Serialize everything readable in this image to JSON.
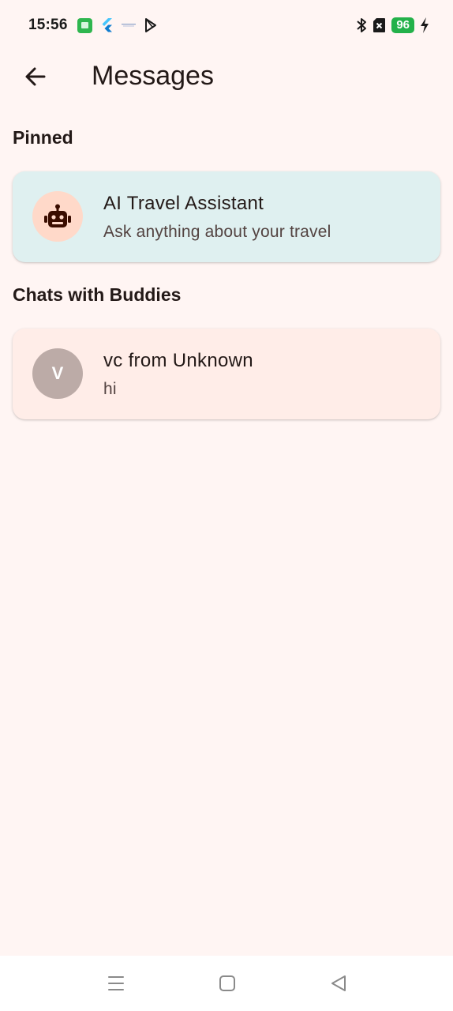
{
  "status_bar": {
    "time": "15:56",
    "battery": "96",
    "icons": [
      "green-app-icon",
      "flutter-icon",
      "notification-dots-icon",
      "play-store-icon",
      "bluetooth-icon",
      "sim-off-icon",
      "charging-bolt-icon"
    ]
  },
  "app_bar": {
    "title": "Messages",
    "back_icon": "arrow-back-icon"
  },
  "pinned": {
    "section_title": "Pinned",
    "items": [
      {
        "name": "AI Travel Assistant",
        "subtitle": "Ask anything about your travel",
        "avatar_icon": "robot-icon"
      }
    ]
  },
  "chats": {
    "section_title": "Chats with Buddies",
    "items": [
      {
        "name": "vc from Unknown",
        "subtitle": "hi",
        "avatar_letter": "V"
      }
    ]
  },
  "nav_bar": {
    "icons": [
      "menu-icon",
      "home-square-icon",
      "back-triangle-icon"
    ]
  },
  "colors": {
    "background": "#fff5f3",
    "pinned_card": "#dff0f0",
    "chat_card": "#ffede8",
    "ai_avatar_bg": "#ffd9c9",
    "letter_avatar_bg": "#bcaba7",
    "battery_badge": "#23b14a"
  }
}
